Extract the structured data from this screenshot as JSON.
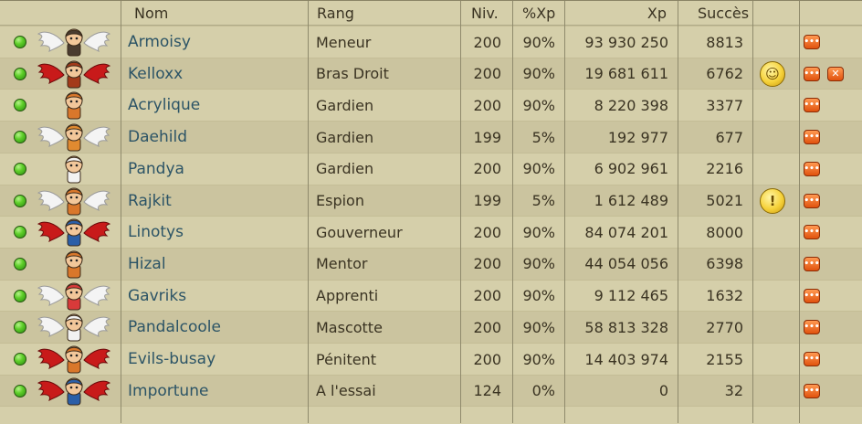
{
  "columns": {
    "name": "Nom",
    "rank": "Rang",
    "level": "Niv.",
    "xp_pct": "%Xp",
    "xp": "Xp",
    "success": "Succès"
  },
  "colors": {
    "row_light": "#d5cfaa",
    "row_dark": "#cbc49f",
    "name_text": "#2c5466",
    "online_dot": "#5fcf2a",
    "action_button": "#e0520e"
  },
  "members": [
    {
      "name": "Armoisy",
      "rank": "Meneur",
      "level": "200",
      "xp_pct": "90%",
      "xp": "93 930 250",
      "success": "8813",
      "wings": "white",
      "emote": "",
      "kick": false
    },
    {
      "name": "Kelloxx",
      "rank": "Bras Droit",
      "level": "200",
      "xp_pct": "90%",
      "xp": "19 681 611",
      "success": "6762",
      "wings": "red",
      "emote": "smiley-icon",
      "kick": true
    },
    {
      "name": "Acrylique",
      "rank": "Gardien",
      "level": "200",
      "xp_pct": "90%",
      "xp": "8 220 398",
      "success": "3377",
      "wings": "none",
      "emote": "",
      "kick": false
    },
    {
      "name": "Daehild",
      "rank": "Gardien",
      "level": "199",
      "xp_pct": "5%",
      "xp": "192 977",
      "success": "677",
      "wings": "white",
      "emote": "",
      "kick": false
    },
    {
      "name": "Pandya",
      "rank": "Gardien",
      "level": "200",
      "xp_pct": "90%",
      "xp": "6 902 961",
      "success": "2216",
      "wings": "none",
      "emote": "",
      "kick": false
    },
    {
      "name": "Rajkit",
      "rank": "Espion",
      "level": "199",
      "xp_pct": "5%",
      "xp": "1 612 489",
      "success": "5021",
      "wings": "white",
      "emote": "surprised-icon",
      "kick": false
    },
    {
      "name": "Linotys",
      "rank": "Gouverneur",
      "level": "200",
      "xp_pct": "90%",
      "xp": "84 074 201",
      "success": "8000",
      "wings": "red",
      "emote": "",
      "kick": false
    },
    {
      "name": "Hizal",
      "rank": "Mentor",
      "level": "200",
      "xp_pct": "90%",
      "xp": "44 054 056",
      "success": "6398",
      "wings": "none",
      "emote": "",
      "kick": false
    },
    {
      "name": "Gavriks",
      "rank": "Apprenti",
      "level": "200",
      "xp_pct": "90%",
      "xp": "9 112 465",
      "success": "1632",
      "wings": "white",
      "emote": "",
      "kick": false
    },
    {
      "name": "Pandalcoole",
      "rank": "Mascotte",
      "level": "200",
      "xp_pct": "90%",
      "xp": "58 813 328",
      "success": "2770",
      "wings": "white",
      "emote": "",
      "kick": false
    },
    {
      "name": "Evils-busay",
      "rank": "Pénitent",
      "level": "200",
      "xp_pct": "90%",
      "xp": "14 403 974",
      "success": "2155",
      "wings": "red",
      "emote": "",
      "kick": false
    },
    {
      "name": "Importune",
      "rank": "A l'essai",
      "level": "124",
      "xp_pct": "0%",
      "xp": "0",
      "success": "32",
      "wings": "red",
      "emote": "",
      "kick": false
    }
  ]
}
